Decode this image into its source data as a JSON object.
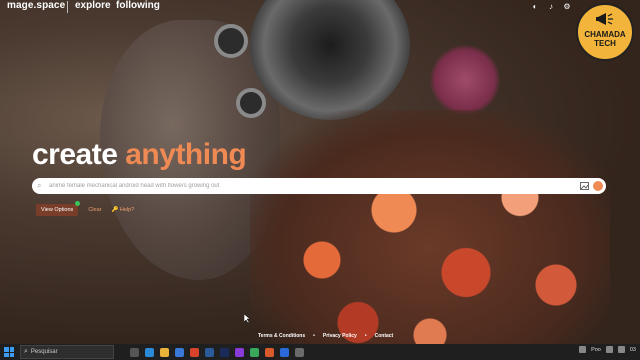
{
  "header": {
    "logo": "mage.space",
    "nav": [
      "explore",
      "following"
    ],
    "icons": [
      "moon-icon",
      "bell-icon",
      "settings-icon"
    ]
  },
  "badge": {
    "line1": "CHAMADA",
    "line2": "TECH",
    "color": "#f2b43a"
  },
  "hero": {
    "headline_part1": "create",
    "headline_part2": "anything",
    "accent_color": "#f08a55"
  },
  "search": {
    "placeholder": "anime female mechanical android head with flowers growing out"
  },
  "options": {
    "view_options": "View Options",
    "clear": "Clear",
    "help": "Help?"
  },
  "footer": {
    "links": [
      "Terms & Conditions",
      "Privacy Policy",
      "Contact"
    ],
    "separator": "•"
  },
  "taskbar": {
    "search_placeholder": "Pesquisar",
    "weather": "Poo",
    "time": "03"
  }
}
